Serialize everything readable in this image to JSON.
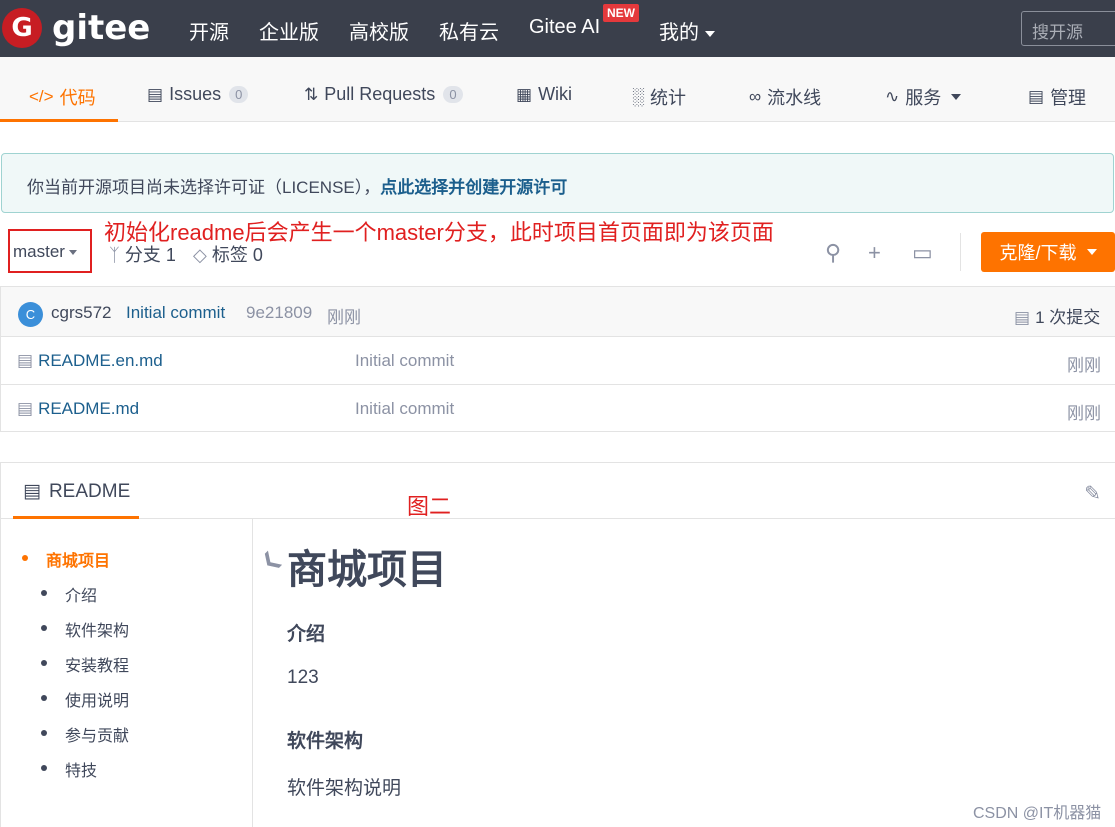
{
  "topnav": {
    "logo_letter": "G",
    "logo_text": "gitee",
    "items": [
      "开源",
      "企业版",
      "高校版",
      "私有云",
      "Gitee AI",
      "我的"
    ],
    "new_badge": "NEW",
    "search_placeholder": "搜开源"
  },
  "tabs": {
    "code": "代码",
    "issues": "Issues",
    "issues_count": "0",
    "pull_requests": "Pull Requests",
    "pr_count": "0",
    "wiki": "Wiki",
    "stats": "统计",
    "pipeline": "流水线",
    "services": "服务",
    "manage": "管理"
  },
  "license": {
    "text": "你当前开源项目尚未选择许可证（LICENSE），",
    "link": "点此选择并创建开源许可"
  },
  "annotations": {
    "top": "初始化readme后会产生一个master分支，此时项目首页面即为该页面",
    "figure": "图二"
  },
  "branch": {
    "name": "master",
    "branches": "分支 1",
    "tags": "标签 0",
    "clone_button": "克隆/下载"
  },
  "commit": {
    "avatar_letter": "C",
    "author": "cgrs572",
    "message": "Initial commit",
    "hash": "9e21809",
    "time": "刚刚",
    "count": "1 次提交"
  },
  "files": [
    {
      "name": "README.en.md",
      "message": "Initial commit",
      "time": "刚刚"
    },
    {
      "name": "README.md",
      "message": "Initial commit",
      "time": "刚刚"
    }
  ],
  "readme": {
    "tab": "README",
    "toc": [
      "商城项目",
      "介绍",
      "软件架构",
      "安装教程",
      "使用说明",
      "参与贡献",
      "特技"
    ],
    "h1": "商城项目",
    "h3_intro": "介绍",
    "p_intro": "123",
    "h3_arch": "软件架构",
    "p_arch": "软件架构说明"
  },
  "watermark": "CSDN @IT机器猫"
}
